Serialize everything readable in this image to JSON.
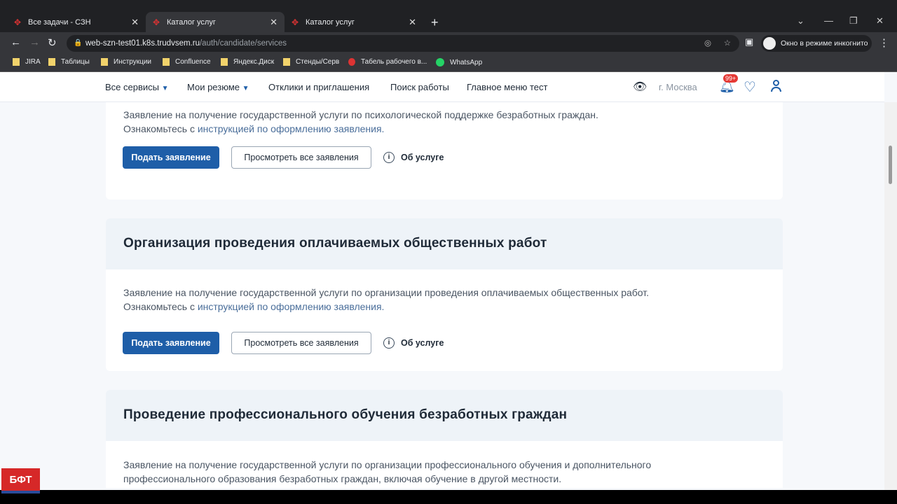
{
  "browser": {
    "tabs": [
      {
        "title": "Все задачи - СЗН"
      },
      {
        "title": "Каталог услуг"
      },
      {
        "title": "Каталог услуг"
      }
    ],
    "url_host": "web-szn-test01.k8s.trudvsem.ru",
    "url_path": "/auth/candidate/services",
    "incognito_label": "Окно в режиме инкогнито",
    "bookmarks": [
      "JIRA",
      "Таблицы",
      "Инструкции",
      "Confluence",
      "Яндекс.Диск",
      "Стенды/Серв",
      "Табель рабочего в...",
      "WhatsApp"
    ]
  },
  "nav": {
    "all_services": "Все сервисы",
    "my_resumes": "Мои резюме",
    "responses": "Отклики и приглашения",
    "job_search": "Поиск работы",
    "main_menu": "Главное меню тест",
    "city": "г. Москва",
    "notif_badge": "99+"
  },
  "cards": [
    {
      "desc1": "Заявление на получение государственной услуги по психологической поддержке безработных граждан.",
      "desc2_pre": "Ознакомьтесь с ",
      "desc2_link": "инструкцией по оформлению заявления."
    },
    {
      "title": "Организация проведения оплачиваемых общественных работ",
      "desc1": "Заявление на получение государственной услуги по организации проведения оплачиваемых общественных работ.",
      "desc2_pre": "Ознакомьтесь с ",
      "desc2_link": "инструкцией по оформлению заявления."
    },
    {
      "title": "Проведение профессионального обучения безработных граждан",
      "desc1": "Заявление на получение государственной услуги по организации профессионального обучения и дополнительного",
      "desc2": "профессионального образования безработных граждан, включая обучение в другой местности."
    }
  ],
  "buttons": {
    "apply": "Подать заявление",
    "view_all": "Просмотреть все заявления",
    "about": "Об услуге"
  },
  "logo": "БФТ"
}
